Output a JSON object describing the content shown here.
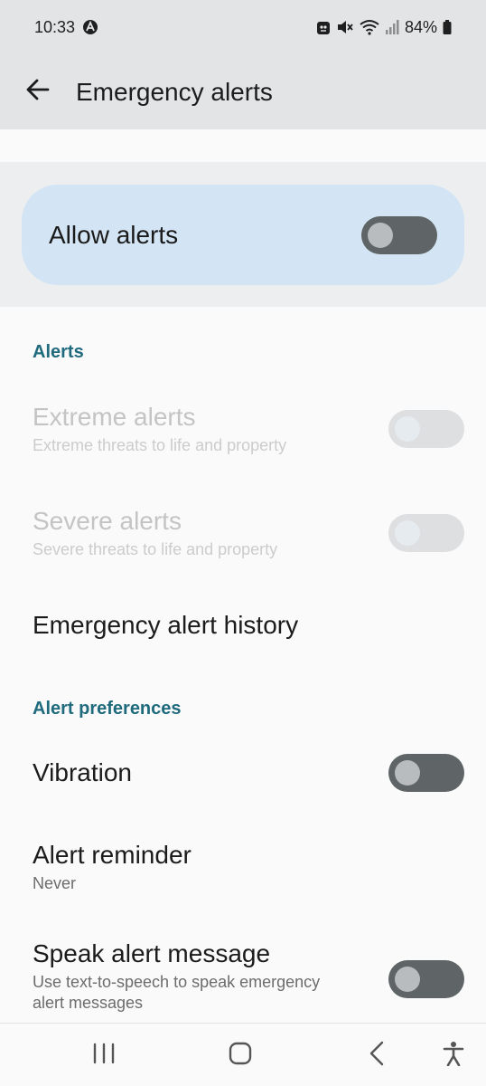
{
  "status_bar": {
    "time": "10:33",
    "battery_percent": "84%",
    "icons": [
      "notification-a-icon",
      "lock-app-icon",
      "mute-icon",
      "wifi-icon",
      "signal-icon",
      "battery-icon"
    ]
  },
  "app_bar": {
    "title": "Emergency alerts",
    "back_icon": "arrow-back-icon"
  },
  "master_switch": {
    "label": "Allow alerts",
    "enabled": false
  },
  "sections": {
    "alerts_header": "Alerts",
    "preferences_header": "Alert preferences"
  },
  "alerts": {
    "extreme": {
      "title": "Extreme alerts",
      "subtitle": "Extreme threats to life and property",
      "enabled": false,
      "disabled": true
    },
    "severe": {
      "title": "Severe alerts",
      "subtitle": "Severe threats to life and property",
      "enabled": false,
      "disabled": true
    },
    "history": {
      "title": "Emergency alert history"
    }
  },
  "preferences": {
    "vibration": {
      "title": "Vibration",
      "enabled": false
    },
    "reminder": {
      "title": "Alert reminder",
      "subtitle": "Never"
    },
    "speak": {
      "title": "Speak alert message",
      "subtitle": "Use text-to-speech to speak emergency alert messages",
      "enabled": false
    }
  },
  "nav_bar": {
    "icons": [
      "recent-apps-icon",
      "home-icon",
      "back-nav-icon",
      "accessibility-icon"
    ]
  },
  "colors": {
    "accent": "#1f6a7d",
    "card_bg": "#d3e4f4",
    "toggle_off": "#5f6566"
  }
}
